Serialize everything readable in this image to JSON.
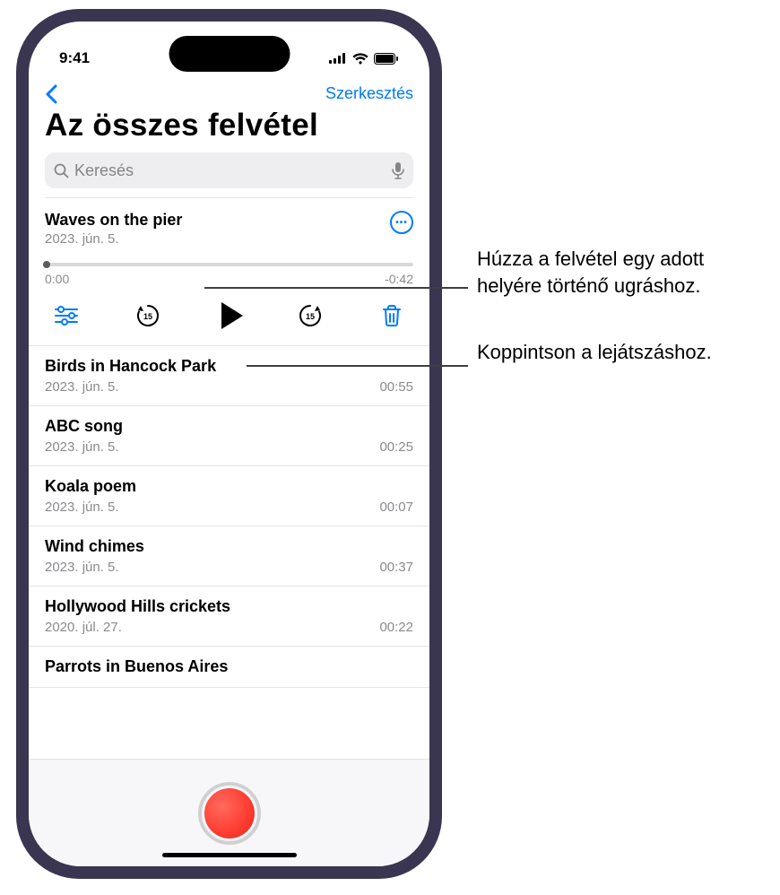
{
  "status": {
    "time": "9:41"
  },
  "nav": {
    "edit": "Szerkesztés"
  },
  "title": "Az összes felvétel",
  "search": {
    "placeholder": "Keresés"
  },
  "selected": {
    "title": "Waves on the pier",
    "date": "2023. jún. 5.",
    "elapsed": "0:00",
    "remaining": "-0:42"
  },
  "items": [
    {
      "title": "Birds in Hancock Park",
      "date": "2023. jún. 5.",
      "duration": "00:55"
    },
    {
      "title": "ABC song",
      "date": "2023. jún. 5.",
      "duration": "00:25"
    },
    {
      "title": "Koala poem",
      "date": "2023. jún. 5.",
      "duration": "00:07"
    },
    {
      "title": "Wind chimes",
      "date": "2023. jún. 5.",
      "duration": "00:37"
    },
    {
      "title": "Hollywood Hills crickets",
      "date": "2020. júl. 27.",
      "duration": "00:22"
    },
    {
      "title": "Parrots in Buenos Aires",
      "date": "",
      "duration": ""
    }
  ],
  "callouts": {
    "scrub": "Húzza a felvétel egy adott helyére történő ugráshoz.",
    "play": "Koppintson a lejátszáshoz."
  }
}
